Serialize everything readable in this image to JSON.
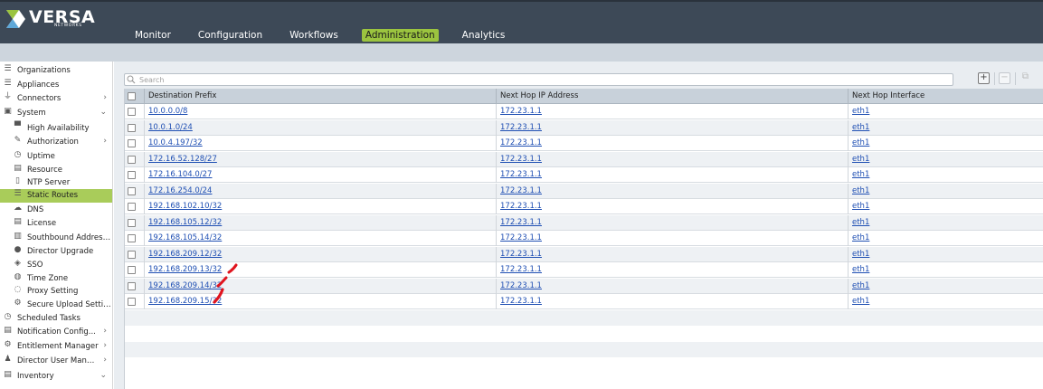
{
  "app": {
    "logo_text": "VERSA",
    "logo_subtext": "NETWORKS"
  },
  "nav": {
    "items": [
      {
        "label": "Monitor",
        "active": false
      },
      {
        "label": "Configuration",
        "active": false
      },
      {
        "label": "Workflows",
        "active": false
      },
      {
        "label": "Administration",
        "active": true
      },
      {
        "label": "Analytics",
        "active": false
      }
    ]
  },
  "sidebar": {
    "items": [
      {
        "label": "Organizations",
        "icon": "organizations-icon",
        "glyph": "☰",
        "indent": 0,
        "chevron": ""
      },
      {
        "label": "Appliances",
        "icon": "appliances-icon",
        "glyph": "☰",
        "indent": 0,
        "chevron": ""
      },
      {
        "label": "Connectors",
        "icon": "connector-icon",
        "glyph": "⏚",
        "indent": 0,
        "chevron": "›"
      },
      {
        "label": "System",
        "icon": "system-icon",
        "glyph": "▣",
        "indent": 0,
        "chevron": "⌄"
      },
      {
        "label": "High Availability",
        "icon": "high-availability-icon",
        "glyph": "▀",
        "indent": 1,
        "chevron": ""
      },
      {
        "label": "Authorization",
        "icon": "authorization-icon",
        "glyph": "✎",
        "indent": 1,
        "chevron": "›"
      },
      {
        "label": "Uptime",
        "icon": "uptime-icon",
        "glyph": "◷",
        "indent": 1,
        "chevron": ""
      },
      {
        "label": "Resource",
        "icon": "resource-icon",
        "glyph": "▤",
        "indent": 1,
        "chevron": ""
      },
      {
        "label": "NTP Server",
        "icon": "ntp-server-icon",
        "glyph": "▯",
        "indent": 1,
        "chevron": ""
      },
      {
        "label": "Static Routes",
        "icon": "static-routes-icon",
        "glyph": "☰",
        "indent": 1,
        "chevron": "",
        "active": true
      },
      {
        "label": "DNS",
        "icon": "dns-icon",
        "glyph": "☁",
        "indent": 1,
        "chevron": ""
      },
      {
        "label": "License",
        "icon": "license-icon",
        "glyph": "▤",
        "indent": 1,
        "chevron": ""
      },
      {
        "label": "Southbound Address...",
        "icon": "southbound-address-icon",
        "glyph": "▥",
        "indent": 1,
        "chevron": ""
      },
      {
        "label": "Director Upgrade",
        "icon": "director-upgrade-icon",
        "glyph": "●",
        "indent": 1,
        "chevron": ""
      },
      {
        "label": "SSO",
        "icon": "sso-icon",
        "glyph": "◈",
        "indent": 1,
        "chevron": ""
      },
      {
        "label": "Time Zone",
        "icon": "time-zone-icon",
        "glyph": "◍",
        "indent": 1,
        "chevron": ""
      },
      {
        "label": "Proxy Setting",
        "icon": "proxy-setting-icon",
        "glyph": "◌",
        "indent": 1,
        "chevron": ""
      },
      {
        "label": "Secure Upload Setting",
        "icon": "secure-upload-icon",
        "glyph": "⚙",
        "indent": 1,
        "chevron": ""
      },
      {
        "label": "Scheduled Tasks",
        "icon": "scheduled-tasks-icon",
        "glyph": "◷",
        "indent": 0,
        "chevron": ""
      },
      {
        "label": "Notification Config...",
        "icon": "notification-config-icon",
        "glyph": "▤",
        "indent": 0,
        "chevron": "›"
      },
      {
        "label": "Entitlement Manager",
        "icon": "entitlement-manager-icon",
        "glyph": "⚙",
        "indent": 0,
        "chevron": "›"
      },
      {
        "label": "Director User Mana...",
        "icon": "director-user-icon",
        "glyph": "♟",
        "indent": 0,
        "chevron": "›"
      },
      {
        "label": "Inventory",
        "icon": "inventory-icon",
        "glyph": "▤",
        "indent": 0,
        "chevron": "⌄"
      }
    ]
  },
  "search": {
    "placeholder": "Search"
  },
  "toolbar": {
    "add_glyph": "+",
    "remove_glyph": "−",
    "clone_glyph": "⧉"
  },
  "table": {
    "headers": [
      "Destination Prefix",
      "Next Hop IP Address",
      "Next Hop Interface"
    ],
    "rows": [
      [
        "10.0.0.0/8",
        "172.23.1.1",
        "eth1"
      ],
      [
        "10.0.1.0/24",
        "172.23.1.1",
        "eth1"
      ],
      [
        "10.0.4.197/32",
        "172.23.1.1",
        "eth1"
      ],
      [
        "172.16.52.128/27",
        "172.23.1.1",
        "eth1"
      ],
      [
        "172.16.104.0/27",
        "172.23.1.1",
        "eth1"
      ],
      [
        "172.16.254.0/24",
        "172.23.1.1",
        "eth1"
      ],
      [
        "192.168.102.10/32",
        "172.23.1.1",
        "eth1"
      ],
      [
        "192.168.105.12/32",
        "172.23.1.1",
        "eth1"
      ],
      [
        "192.168.105.14/32",
        "172.23.1.1",
        "eth1"
      ],
      [
        "192.168.209.12/32",
        "172.23.1.1",
        "eth1"
      ],
      [
        "192.168.209.13/32",
        "172.23.1.1",
        "eth1"
      ],
      [
        "192.168.209.14/32",
        "172.23.1.1",
        "eth1"
      ],
      [
        "192.168.209.15/32",
        "172.23.1.1",
        "eth1"
      ]
    ],
    "empty_rows": 4
  },
  "colors": {
    "header_bg": "#3d4957",
    "active_accent": "#9bc43f",
    "annotation_red": "#e0141e",
    "link": "#1f4fb3"
  }
}
